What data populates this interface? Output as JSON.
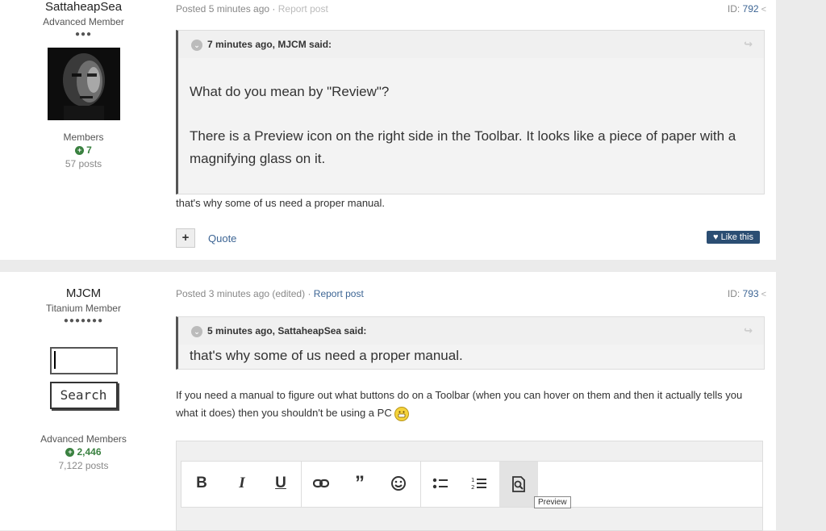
{
  "post1": {
    "author": {
      "name": "SattaheapSea",
      "rank": "Advanced Member",
      "pips": "●●●",
      "group": "Members",
      "reputation": "7",
      "posts": "57 posts"
    },
    "posted": "Posted 5 minutes ago",
    "separator": " · ",
    "report": "Report post",
    "id_label": "ID: ",
    "id": "792",
    "quote": {
      "header": "7 minutes ago, MJCM said:",
      "line1": "What do you mean by  \"Review\"?",
      "line2": "There is a Preview icon on the right side in the Toolbar. It looks like a piece of paper with a magnifying glass on it."
    },
    "body": "that's why some of us need a proper manual.",
    "quote_button": "Quote",
    "like_button": "Like this"
  },
  "post2": {
    "author": {
      "name": "MJCM",
      "rank": "Titanium Member",
      "pips": "●●●●●●●",
      "search_button": "Search",
      "group": "Advanced Members",
      "reputation": "2,446",
      "posts": "7,122 posts"
    },
    "posted": "Posted 3 minutes ago (edited)",
    "separator": " · ",
    "report": "Report post",
    "id_label": "ID: ",
    "id": "793",
    "quote": {
      "header": "5 minutes ago, SattaheapSea said:",
      "line1": "that's why some of us need a proper manual."
    },
    "body": "If you need a manual to figure out what buttons do on a Toolbar (when you can hover on them and then it actually tells you what it does) then you shouldn't be using a PC"
  },
  "editor": {
    "tooltip": "Preview",
    "buttons": [
      "bold-icon",
      "italic-icon",
      "underline-icon",
      "link-icon",
      "quote-icon",
      "emoji-icon",
      "bullet-list-icon",
      "numbered-list-icon",
      "preview-icon"
    ]
  },
  "colors": {
    "link": "#3d6594",
    "reputation": "#3a8140",
    "like_button": "#2b4e73"
  }
}
